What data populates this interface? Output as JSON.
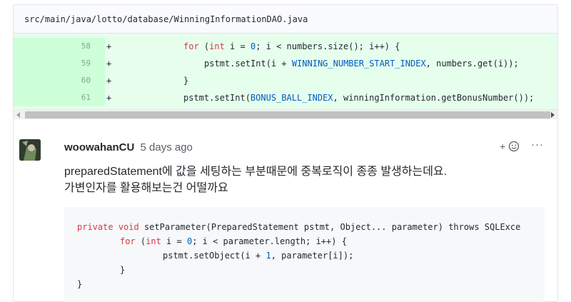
{
  "file": {
    "path": "src/main/java/lotto/database/WinningInformationDAO.java"
  },
  "diff": {
    "lines": [
      {
        "num": "58",
        "mark": "+",
        "code": [
          "for",
          " (",
          "int",
          " i = ",
          "0",
          "; i < numbers.size(); i++) {"
        ]
      },
      {
        "num": "59",
        "mark": "+",
        "code": [
          "pstmt.setInt(i + ",
          "WINNING_NUMBER_START_INDEX",
          ", numbers.get(i));"
        ]
      },
      {
        "num": "60",
        "mark": "+",
        "code": [
          "}"
        ]
      },
      {
        "num": "61",
        "mark": "+",
        "code": [
          "pstmt.setInt(",
          "BONUS_BALL_INDEX",
          ", winningInformation.getBonusNumber());"
        ]
      }
    ]
  },
  "comment": {
    "author": "woowahanCU",
    "time": "5 days ago",
    "reaction_label": "+",
    "more_label": "···",
    "body_line1": "preparedStatement에 값을 세팅하는 부분때문에 중복로직이 종종 발생하는데요.",
    "body_line2": "가변인자를 활용해보는건 어떨까요",
    "code": {
      "l1_kw1": "private",
      "l1_kw2": "void",
      "l1_rest": " setParameter(PreparedStatement pstmt, Object... parameter) throws SQLExce",
      "l2_kw": "for",
      "l2_a": " (",
      "l2_int": "int",
      "l2_b": " i = ",
      "l2_num": "0",
      "l2_c": "; i < parameter.length; i++) {",
      "l3_a": "pstmt.setObject(i + ",
      "l3_num": "1",
      "l3_b": ", parameter[i]);",
      "l4": "}",
      "l5": "}"
    }
  },
  "colors": {
    "added_bg": "#e6ffed",
    "added_num_bg": "#cdffd8",
    "keyword": "#d73a49",
    "constant": "#005cc5"
  }
}
